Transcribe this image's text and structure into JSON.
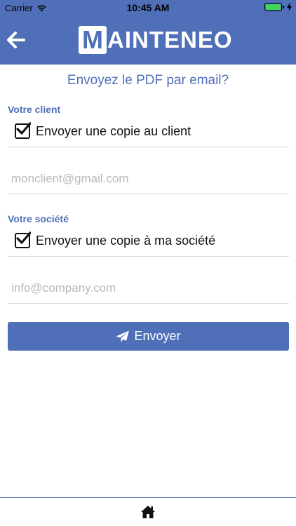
{
  "status_bar": {
    "carrier": "Carrier",
    "time": "10:45 AM",
    "battery_color": "#41d65a"
  },
  "nav": {
    "back_icon": "arrow-left-icon",
    "logo_letter": "M",
    "logo_text": "AINTENEO"
  },
  "page": {
    "title": "Envoyez le PDF par email?"
  },
  "client": {
    "section_label": "Votre client",
    "checkbox_label": "Envoyer une copie au client",
    "checked": true,
    "email_placeholder": "monclient@gmail.com",
    "email_value": ""
  },
  "company": {
    "section_label": "Votre société",
    "checkbox_label": "Envoyer une copie à ma société",
    "checked": true,
    "email_placeholder": "info@company.com",
    "email_value": ""
  },
  "actions": {
    "send_label": "Envoyer",
    "send_icon": "paper-plane-icon"
  },
  "tab_bar": {
    "home_icon": "home-icon"
  },
  "colors": {
    "primary": "#4f6fb8",
    "divider": "#d4d4d4",
    "placeholder": "#b8b8b8"
  }
}
